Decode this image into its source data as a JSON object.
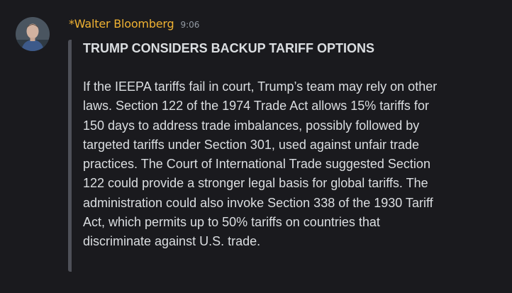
{
  "message": {
    "author": "*Walter Bloomberg",
    "timestamp": "9:06",
    "embed": {
      "title": "TRUMP CONSIDERS BACKUP TARIFF OPTIONS",
      "description": "If the IEEPA tariffs fail in court, Trump’s team may rely on other laws. Section 122 of the 1974 Trade Act allows 15% tariffs for 150 days to address trade imbalances, possibly followed by targeted tariffs under Section 301, used against unfair trade practices. The Court of International Trade suggested Section 122 could provide a stronger legal basis for global tariffs. The administration could also invoke Section 338 of the 1930 Tariff Act, which permits up to 50% tariffs on countries that discriminate against U.S. trade."
    }
  },
  "colors": {
    "background": "#1a1a1e",
    "author": "#f0b232",
    "timestamp": "#949ba4",
    "text": "#dbdee1",
    "embed_bar": "#4e5058"
  },
  "icons": {
    "avatar": "user-avatar-photo"
  }
}
